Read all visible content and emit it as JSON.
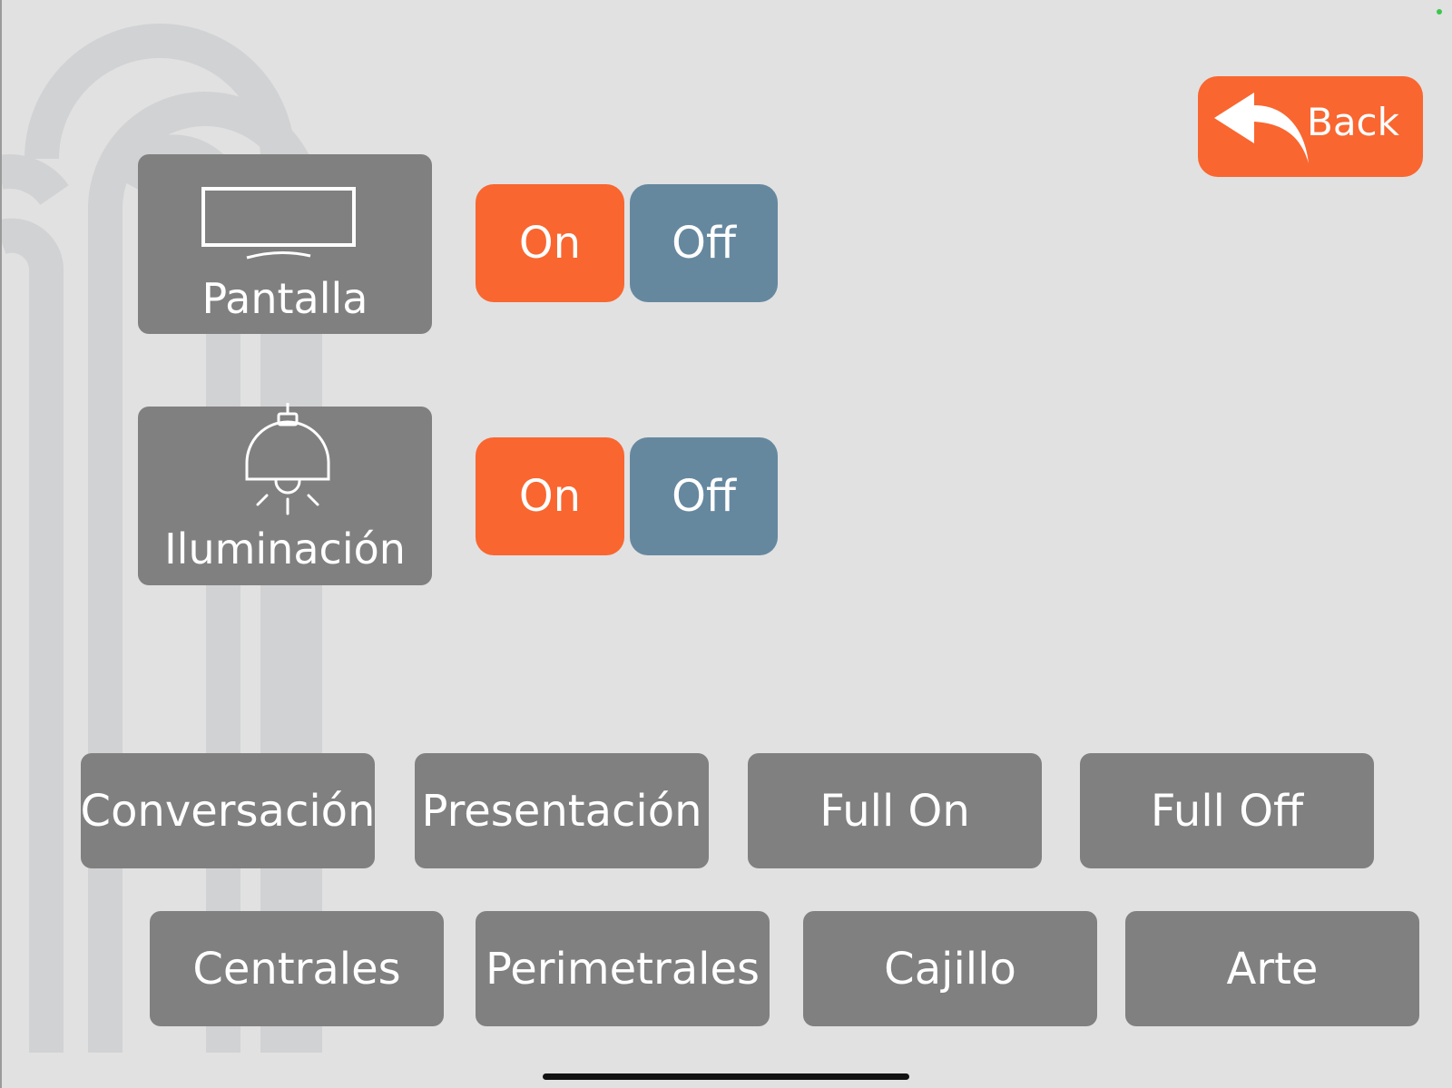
{
  "navigation": {
    "back_label": "Back"
  },
  "devices": [
    {
      "label": "Pantalla",
      "icon": "display-icon",
      "on_label": "On",
      "off_label": "Off"
    },
    {
      "label": "Iluminación",
      "icon": "ceiling-lamp-icon",
      "on_label": "On",
      "off_label": "Off"
    }
  ],
  "scenes": [
    "Conversación",
    "Presentación",
    "Full On",
    "Full Off"
  ],
  "zones": [
    "Centrales",
    "Perimetrales",
    "Cajillo",
    "Arte"
  ],
  "colors": {
    "background": "#e1e1e1",
    "tile": "#808080",
    "accent_on": "#f96630",
    "accent_off": "#65889f",
    "text": "#ffffff"
  }
}
